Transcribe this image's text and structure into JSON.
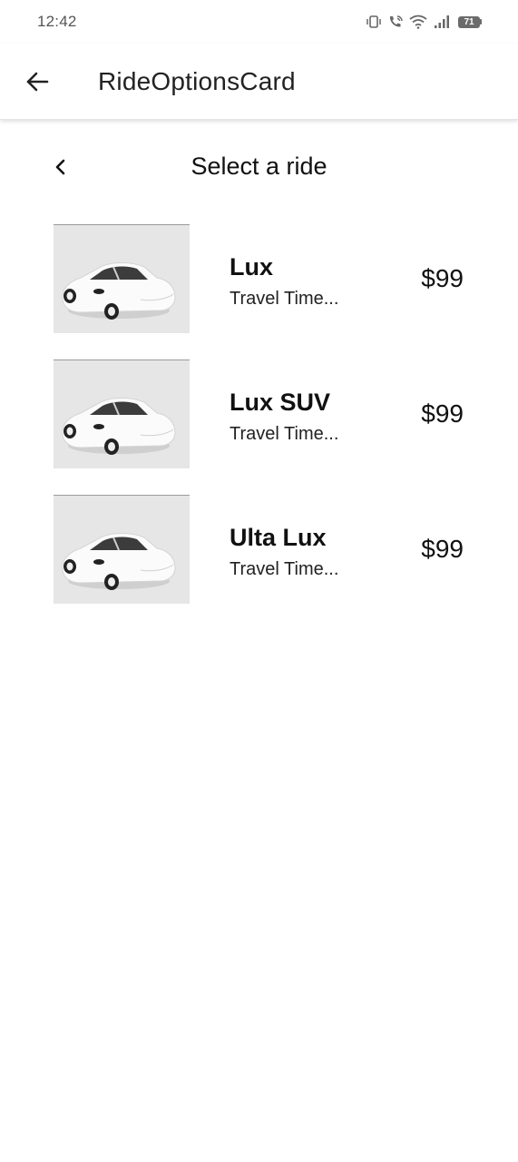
{
  "status_bar": {
    "time": "12:42",
    "battery": "71",
    "icons": [
      "vibrate-icon",
      "wifi-calling-icon",
      "wifi-icon",
      "signal-icon",
      "battery-icon"
    ]
  },
  "app_bar": {
    "title": "RideOptionsCard",
    "back_icon": "arrow-left-icon"
  },
  "ride_header": {
    "title": "Select a ride",
    "back_icon": "chevron-left-icon"
  },
  "rides": [
    {
      "name": "Lux",
      "subtitle": "Travel Time...",
      "price": "$99",
      "image": "car-image"
    },
    {
      "name": "Lux SUV",
      "subtitle": "Travel Time...",
      "price": "$99",
      "image": "car-image"
    },
    {
      "name": "Ulta Lux",
      "subtitle": "Travel Time...",
      "price": "$99",
      "image": "car-image"
    }
  ],
  "colors": {
    "background": "#ffffff",
    "image_background": "#e6e6e6",
    "text": "#111111"
  }
}
